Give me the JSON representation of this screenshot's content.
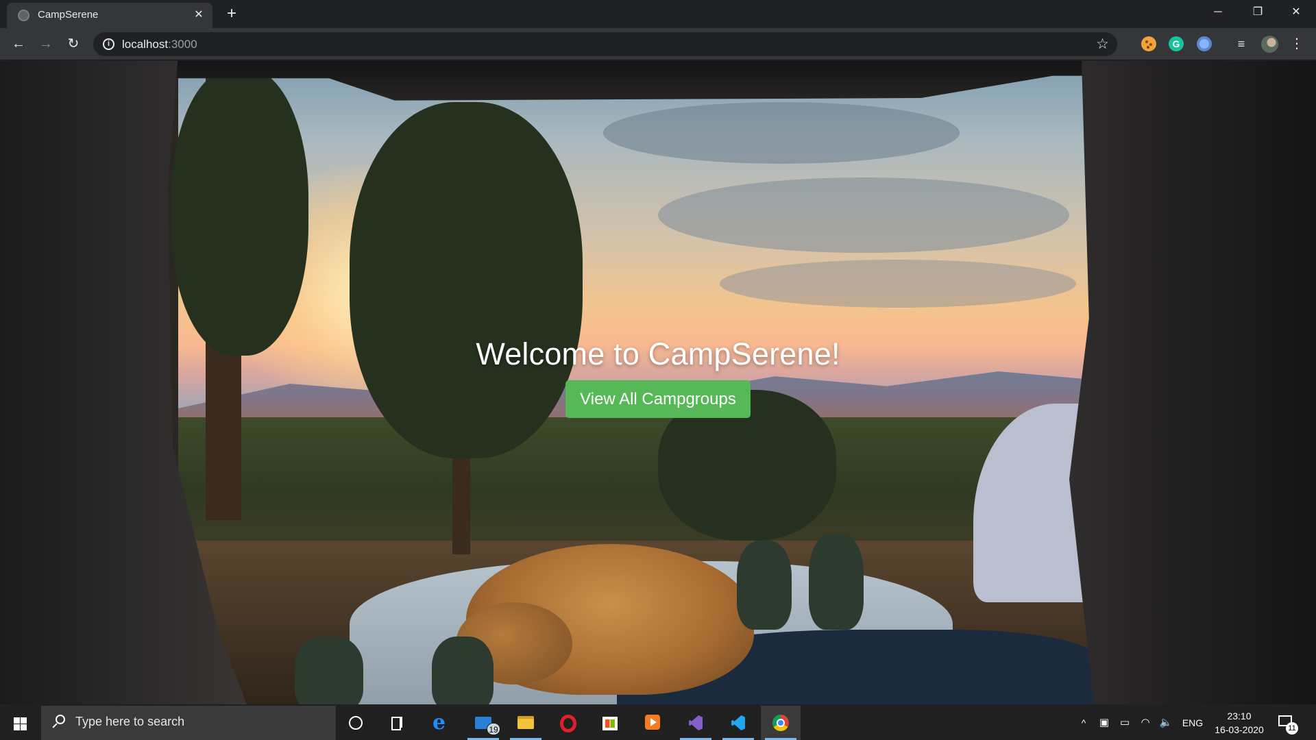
{
  "browser": {
    "tab_title": "CampSerene",
    "tab_close": "✕",
    "new_tab": "+",
    "url_host": "localhost",
    "url_port": ":3000",
    "window_min": "─",
    "window_max": "❐",
    "window_close": "✕",
    "back": "←",
    "forward": "→",
    "reload": "↻",
    "star": "☆",
    "grammarly": "G",
    "menu": "⋮",
    "media_controls": "≡"
  },
  "page": {
    "title": "Welcome to CampSerene!",
    "button_label": "View All Campgroups"
  },
  "taskbar": {
    "search_placeholder": "Type here to search",
    "mail_badge": "19",
    "edge_glyph": "e",
    "tray_chevron": "^",
    "tray_defender": "▣",
    "tray_battery": "▭",
    "tray_wifi": "◠",
    "tray_volume": "🔈",
    "language": "ENG",
    "time": "23:10",
    "date": "16-03-2020",
    "notification_count": "11"
  },
  "colors": {
    "button_green": "#56b856",
    "chrome_dark": "#202124",
    "toolbar": "#35363a",
    "taskbar": "#202020"
  }
}
